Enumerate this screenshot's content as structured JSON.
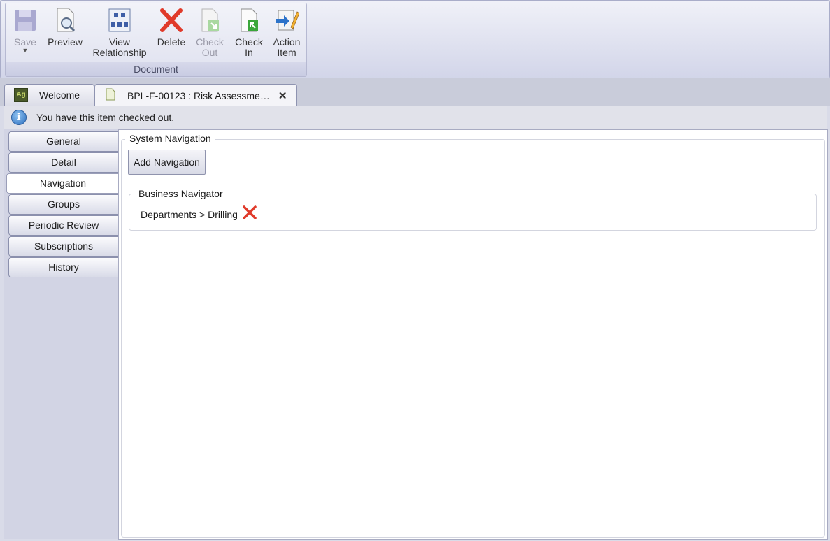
{
  "ribbon": {
    "buttons": [
      {
        "label": "Save",
        "icon": "save-icon",
        "disabled": true
      },
      {
        "label": "Preview",
        "icon": "preview-icon",
        "disabled": false
      },
      {
        "label": "View\nRelationship",
        "icon": "relationship-icon",
        "disabled": false
      },
      {
        "label": "Delete",
        "icon": "delete-icon",
        "disabled": false
      },
      {
        "label": "Check\nOut",
        "icon": "check-out-icon",
        "disabled": true
      },
      {
        "label": "Check\nIn",
        "icon": "check-in-icon",
        "disabled": false
      },
      {
        "label": "Action\nItem",
        "icon": "action-item-icon",
        "disabled": false
      }
    ],
    "group_label": "Document"
  },
  "tabs": [
    {
      "label": "Welcome",
      "icon": "ag-logo-icon"
    },
    {
      "label": "BPL-F-00123 : Risk Assessme…",
      "icon": "document-icon",
      "closable": true
    }
  ],
  "info": {
    "message": "You have this item checked out."
  },
  "leftnav": {
    "items": [
      "General",
      "Detail",
      "Navigation",
      "Groups",
      "Periodic Review",
      "Subscriptions",
      "History"
    ],
    "active": "Navigation"
  },
  "content": {
    "system_navigation_legend": "System Navigation",
    "add_navigation_label": "Add Navigation",
    "business_navigator_legend": "Business Navigator",
    "navigation_path": "Departments > Drilling"
  },
  "colors": {
    "delete_red": "#e03a2a",
    "accent_blue": "#2c6fc0",
    "check_green": "#3aa63a"
  }
}
